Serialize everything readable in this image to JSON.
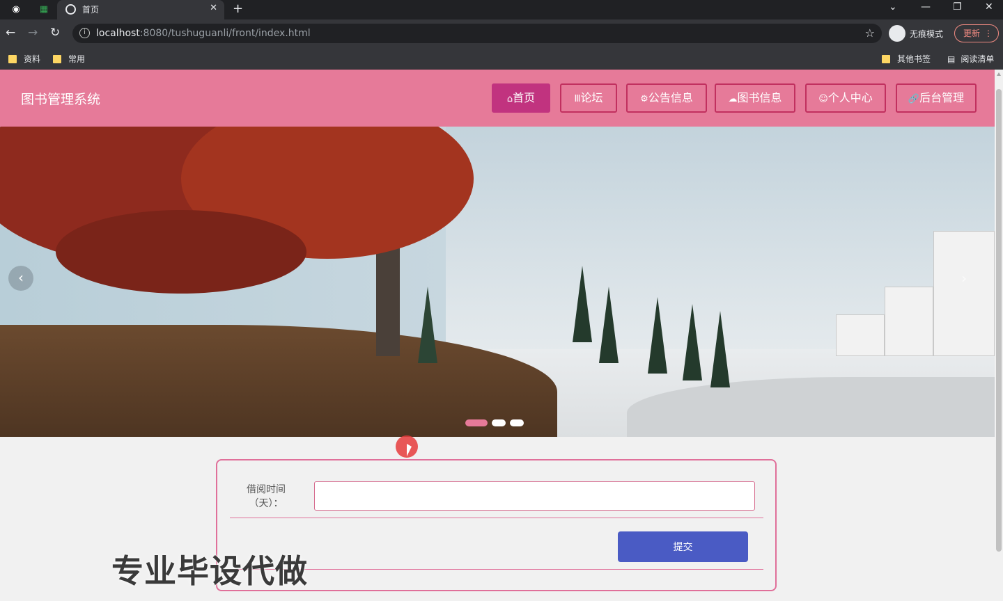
{
  "browser": {
    "tab_title": "首页",
    "url_host": "localhost",
    "url_path": ":8080/tushuguanli/front/index.html",
    "incognito_label": "无痕模式",
    "update_label": "更新",
    "bookmarks": [
      "资料",
      "常用"
    ],
    "bookmarks_right": [
      "其他书签",
      "阅读清单"
    ]
  },
  "site": {
    "title": "图书管理系统",
    "nav": [
      {
        "label": "首页",
        "icon": "home-icon",
        "glyph": "⌂",
        "active": true
      },
      {
        "label": "论坛",
        "icon": "forum-icon",
        "glyph": "Ⅲ",
        "active": false
      },
      {
        "label": "公告信息",
        "icon": "gear-icon",
        "glyph": "⚙",
        "active": false
      },
      {
        "label": "图书信息",
        "icon": "cloud-icon",
        "glyph": "☁",
        "active": false
      },
      {
        "label": "个人中心",
        "icon": "user-icon",
        "glyph": "☺",
        "active": false
      },
      {
        "label": "后台管理",
        "icon": "link-icon",
        "glyph": "🔗",
        "active": false
      }
    ],
    "accent": "#e67a99"
  },
  "banner": {
    "slide_count": 3,
    "active_slide": 1
  },
  "form": {
    "label_line1": "借阅时间",
    "label_line2": "（天）：",
    "input_value": "",
    "submit_label": "提交"
  },
  "watermark": "专业毕设代做"
}
